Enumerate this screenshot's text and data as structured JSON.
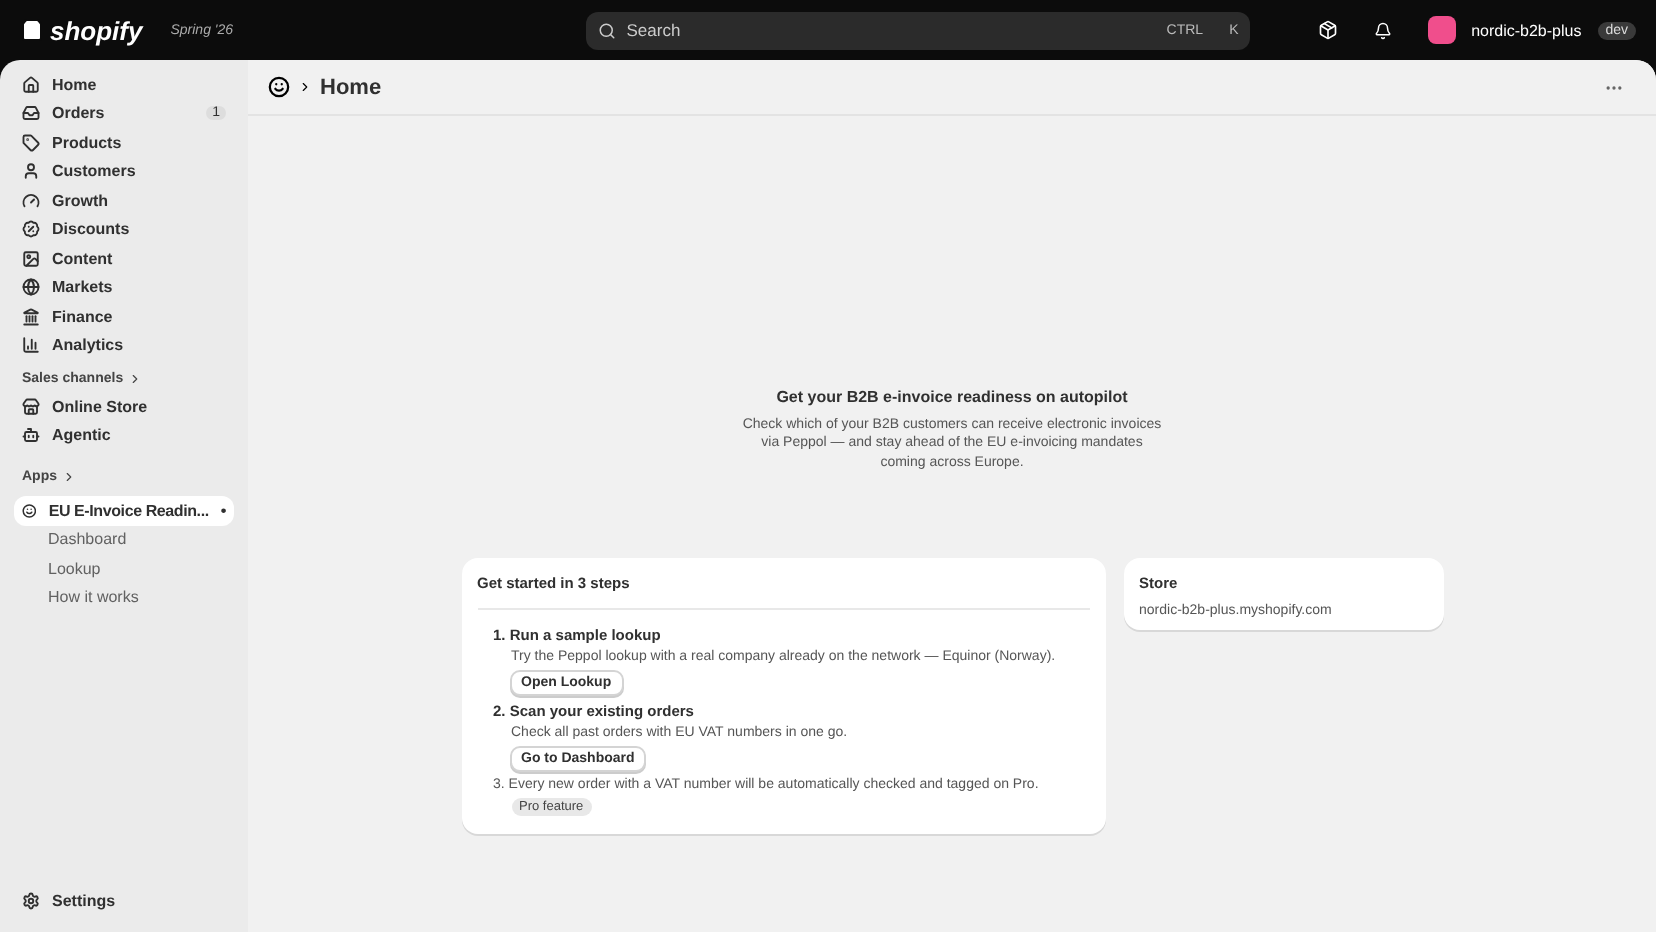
{
  "topbar": {
    "logo": "shopify",
    "edition": "Spring '26",
    "search": {
      "placeholder": "Search",
      "shortcut": [
        "CTRL",
        "K"
      ]
    },
    "store": {
      "name": "nordic-b2b-plus",
      "badge": "dev"
    }
  },
  "sidebar": {
    "items": [
      {
        "label": "Home",
        "selected": false
      },
      {
        "label": "Orders",
        "selected": false,
        "count": "1"
      },
      {
        "label": "Products",
        "selected": false
      },
      {
        "label": "Customers",
        "selected": false
      },
      {
        "label": "Growth",
        "selected": false
      },
      {
        "label": "Discounts",
        "selected": false
      },
      {
        "label": "Content",
        "selected": false
      },
      {
        "label": "Markets",
        "selected": false
      },
      {
        "label": "Finance",
        "selected": false
      },
      {
        "label": "Analytics",
        "selected": false
      }
    ],
    "sales_channels": {
      "heading": "Sales channels",
      "items": [
        {
          "label": "Online Store",
          "selected": false
        },
        {
          "label": "Agentic",
          "selected": false
        }
      ]
    },
    "apps": {
      "heading": "Apps",
      "app": {
        "label": "EU E-Invoice Readin...",
        "selected": true,
        "pin": "•"
      },
      "children": [
        {
          "label": "Dashboard",
          "selected": false
        },
        {
          "label": "Lookup",
          "selected": false
        },
        {
          "label": "How it works",
          "selected": false
        }
      ]
    },
    "settings": "Settings"
  },
  "page": {
    "title": "Home",
    "hero": {
      "title": "Get your B2B e-invoice readiness on autopilot",
      "text": "Check which of your B2B customers can receive electronic invoices via Peppol — and stay ahead of the EU e-invoicing mandates coming across Europe."
    },
    "steps_card": {
      "title": "Get started in 3 steps",
      "steps": [
        {
          "kind": "action",
          "number": "1.",
          "title": "Run a sample lookup",
          "text": "Try the Peppol lookup with a real company already on the network — Equinor (Norway).",
          "button": "Open Lookup"
        },
        {
          "kind": "action",
          "number": "2.",
          "title": "Scan your existing orders",
          "text": "Check all past orders with EU VAT numbers in one go.",
          "button": "Go to Dashboard"
        },
        {
          "kind": "note",
          "number": "3.",
          "text": "Every new order with a VAT number will be automatically checked and tagged on Pro.",
          "badge": "Pro feature"
        }
      ]
    },
    "store_card": {
      "title": "Store",
      "domain": "nordic-b2b-plus.myshopify.com"
    }
  }
}
